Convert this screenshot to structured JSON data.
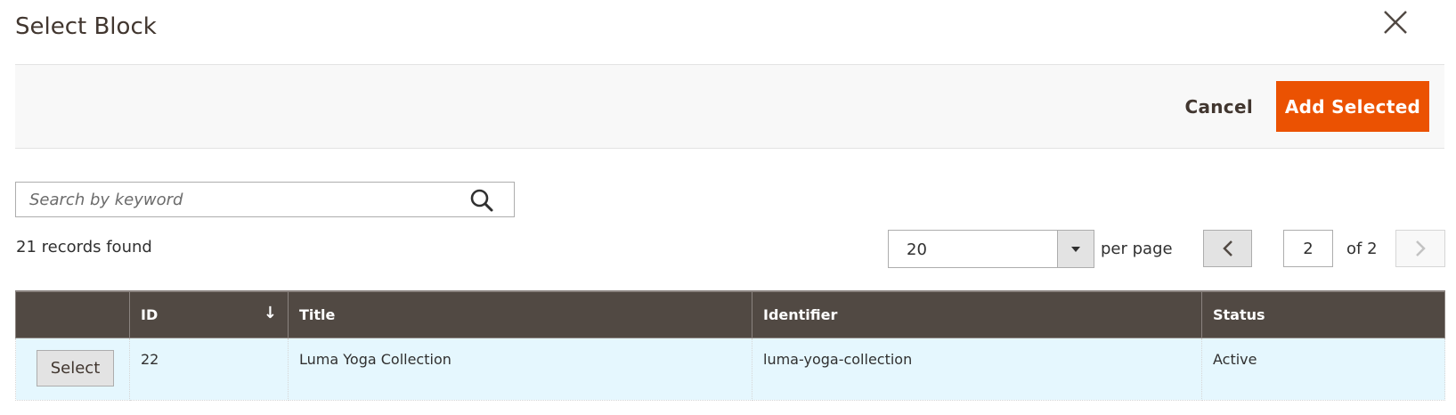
{
  "modal": {
    "title": "Select Block"
  },
  "actions": {
    "cancel_label": "Cancel",
    "add_label": "Add Selected"
  },
  "search": {
    "placeholder": "Search by keyword",
    "value": ""
  },
  "records_found": "21 records found",
  "pagination": {
    "per_page_value": "20",
    "per_page_label": "per page",
    "current_page": "2",
    "of_label": "of 2"
  },
  "grid": {
    "columns": [
      {
        "label": ""
      },
      {
        "label": "ID",
        "sort": "desc"
      },
      {
        "label": "Title"
      },
      {
        "label": "Identifier"
      },
      {
        "label": "Status"
      }
    ],
    "rows": [
      {
        "action_label": "Select",
        "id": "22",
        "title": "Luma Yoga Collection",
        "identifier": "luma-yoga-collection",
        "status": "Active"
      }
    ]
  },
  "icons": {
    "close": "close-icon",
    "search": "search-icon",
    "dropdown": "caret-down-icon",
    "prev": "chevron-left-icon",
    "next": "chevron-right-icon",
    "sort": "sort-arrow-down-icon"
  },
  "colors": {
    "accent": "#eb5202",
    "header_bg": "#514943",
    "row_bg": "#e5f7fe"
  }
}
